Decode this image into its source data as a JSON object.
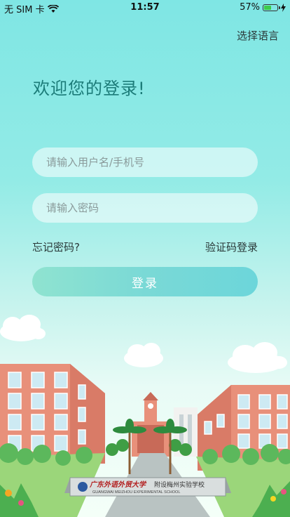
{
  "status": {
    "carrier": "无 SIM 卡",
    "time": "11:57",
    "battery": "57%",
    "battery_level": 0.57
  },
  "header": {
    "language_label": "选择语言"
  },
  "login": {
    "welcome": "欢迎您的登录!",
    "username_placeholder": "请输入用户名/手机号",
    "password_placeholder": "请输入密码",
    "forgot_label": "忘记密码?",
    "sms_login_label": "验证码登录",
    "submit_label": "登录"
  },
  "school": {
    "name_cn": "广东外语外贸大学",
    "name_suffix": "附设梅州实验学校",
    "name_en": "GUANGWAI MEIZHOU EXPERIMENTAL SCHOOL"
  },
  "colors": {
    "accent": "#1c7c79",
    "button": "#7ad9d6",
    "background_top": "#7fe6e4"
  }
}
